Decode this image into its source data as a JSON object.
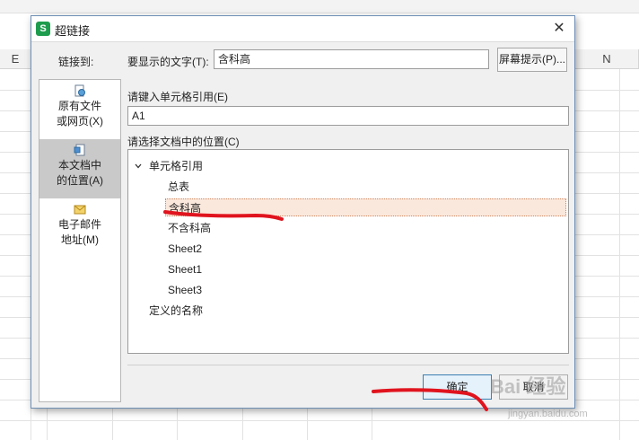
{
  "spreadsheet": {
    "column_e": "E",
    "column_n": "N"
  },
  "dialog": {
    "title": "超链接",
    "app_icon_glyph": "S",
    "close_glyph": "✕",
    "link_to_label": "链接到:",
    "sidebar": {
      "items": [
        {
          "label": "原有文件\n或网页(X)",
          "icon": "file-web-icon",
          "selected": false
        },
        {
          "label": "本文档中\n的位置(A)",
          "icon": "document-location-icon",
          "selected": true
        },
        {
          "label": "电子邮件\n地址(M)",
          "icon": "email-icon",
          "selected": false
        }
      ]
    },
    "display_text_label": "要显示的文字(T):",
    "display_text_value": "含科高",
    "screen_tip_button": "屏幕提示(P)...",
    "cell_ref_label": "请键入单元格引用(E)",
    "cell_ref_value": "A1",
    "location_label": "请选择文档中的位置(C)",
    "tree": {
      "group_cell_ref": "单元格引用",
      "sheets": [
        "总表",
        "含科高",
        "不含科高",
        "Sheet2",
        "Sheet1",
        "Sheet3"
      ],
      "selected_sheet": "含科高",
      "group_defined_names": "定义的名称"
    },
    "ok_button": "确定",
    "cancel_button": "取消"
  },
  "watermark": {
    "text": "Bai 经验",
    "url": "jingyan.baidu.com"
  },
  "colors": {
    "accent_blue": "#3c7fb1",
    "selection_fill": "#fbe8dc",
    "annotation_red": "#e0141e",
    "wps_green": "#1e9c4d"
  }
}
